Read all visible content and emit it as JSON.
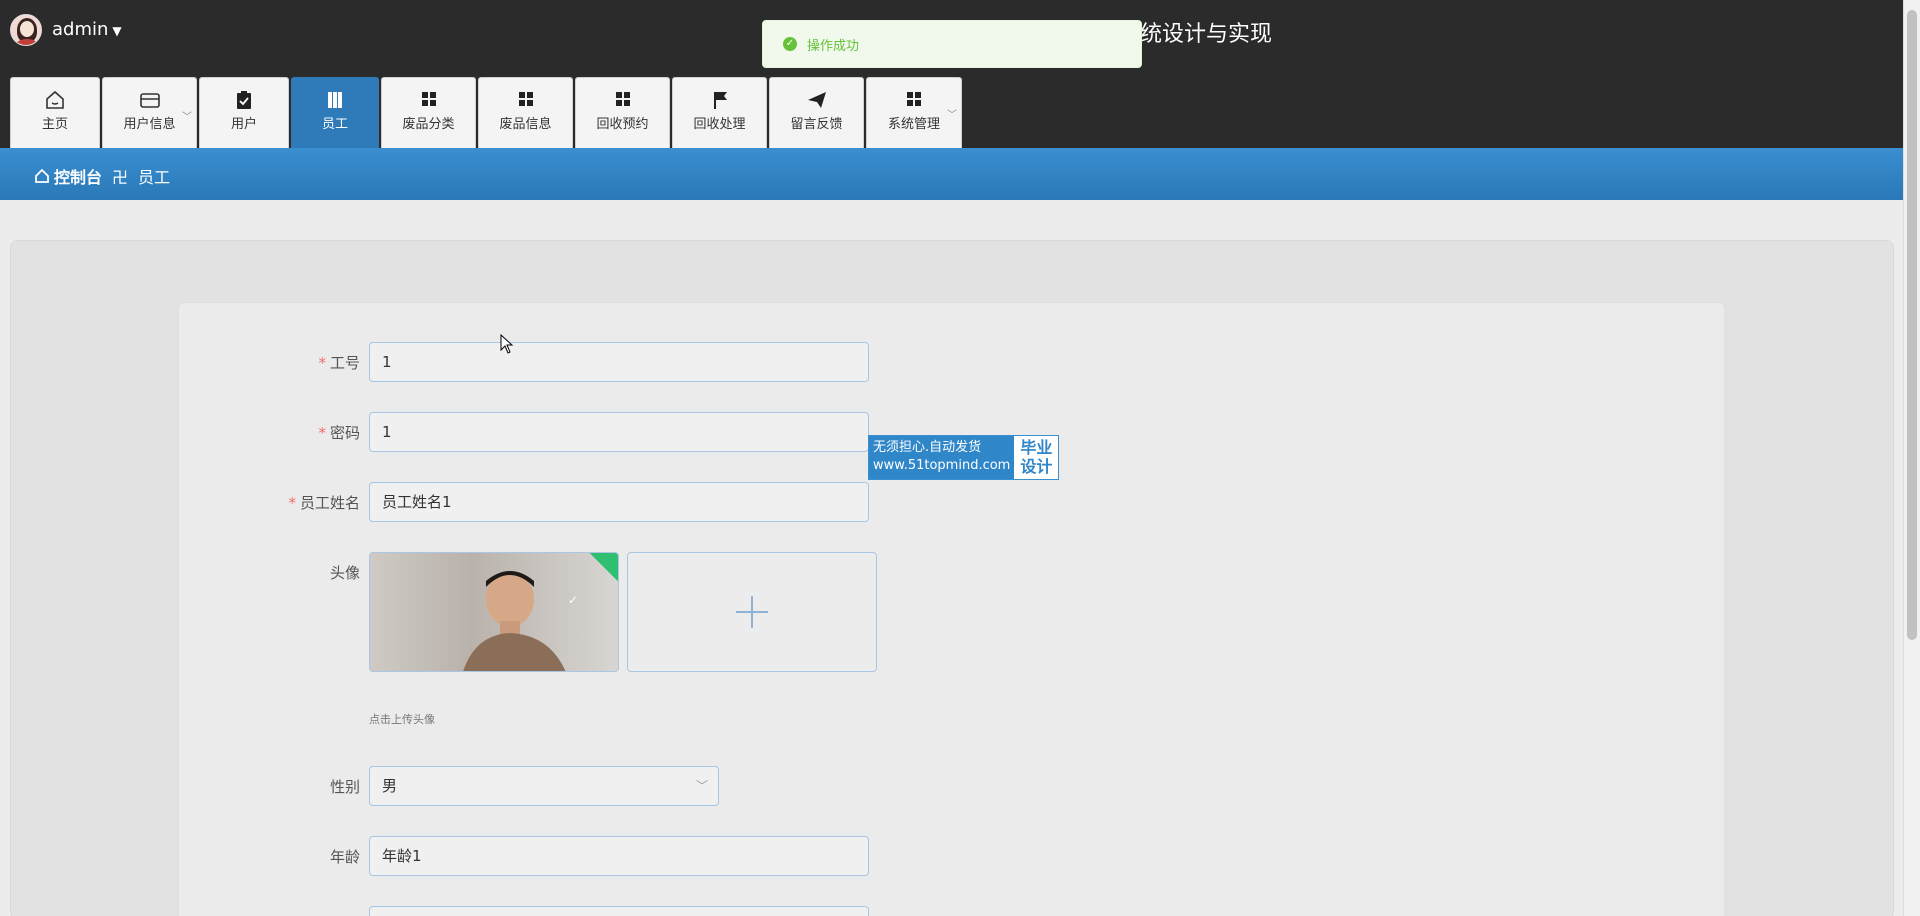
{
  "header": {
    "username": "admin",
    "title_visible": "统设计与实现"
  },
  "nav": {
    "tabs": [
      {
        "label": "主页",
        "icon": "home-icon"
      },
      {
        "label": "用户信息",
        "icon": "wallet-icon",
        "dropdown": true
      },
      {
        "label": "用户",
        "icon": "clipboard-icon"
      },
      {
        "label": "员工",
        "icon": "book-icon",
        "active": true
      },
      {
        "label": "废品分类",
        "icon": "grid-icon"
      },
      {
        "label": "废品信息",
        "icon": "grid-icon"
      },
      {
        "label": "回收预约",
        "icon": "grid-icon"
      },
      {
        "label": "回收处理",
        "icon": "flag-icon"
      },
      {
        "label": "留言反馈",
        "icon": "send-icon"
      },
      {
        "label": "系统管理",
        "icon": "grid-icon",
        "dropdown": true
      }
    ]
  },
  "breadcrumb": {
    "home": "控制台",
    "separator": "卍",
    "current": "员工"
  },
  "toast": {
    "message": "操作成功"
  },
  "form": {
    "employee_no": {
      "label": "工号",
      "value": "1",
      "required": true
    },
    "password": {
      "label": "密码",
      "value": "1",
      "required": true
    },
    "employee_name": {
      "label": "员工姓名",
      "value": "员工姓名1",
      "required": true
    },
    "avatar": {
      "label": "头像",
      "tip": "点击上传头像"
    },
    "gender": {
      "label": "性别",
      "value": "男"
    },
    "age": {
      "label": "年龄",
      "value": "年龄1"
    }
  },
  "watermark": {
    "line1": "无须担心.自动发货",
    "line2": "www.51topmind.com",
    "side1": "毕业",
    "side2": "设计"
  },
  "colors": {
    "accent": "#2f7ab8",
    "header_bg": "#2b2b2b",
    "required": "#f56c6c",
    "success": "#67c23a"
  }
}
